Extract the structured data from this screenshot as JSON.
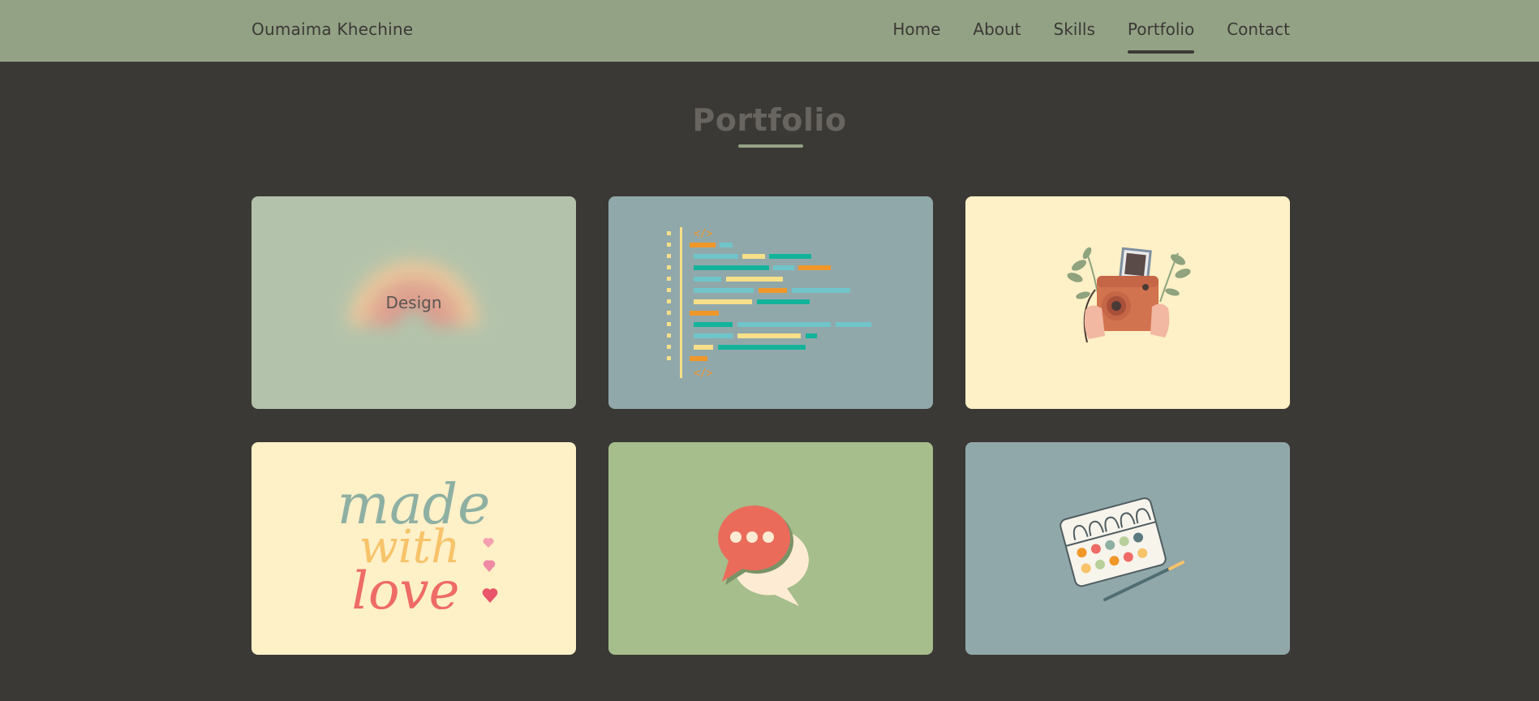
{
  "nav": {
    "brand": "Oumaima Khechine",
    "links": [
      {
        "label": "Home",
        "active": false
      },
      {
        "label": "About",
        "active": false
      },
      {
        "label": "Skills",
        "active": false
      },
      {
        "label": "Portfolio",
        "active": true
      },
      {
        "label": "Contact",
        "active": false
      }
    ]
  },
  "section": {
    "title": "Portfolio"
  },
  "portfolio": {
    "items": [
      {
        "label": "Design",
        "icon": "rainbow-icon",
        "bg": "#b3c3ab"
      },
      {
        "label": "",
        "icon": "code-icon",
        "bg": "#91a8aa"
      },
      {
        "label": "",
        "icon": "camera-icon",
        "bg": "#fef0c7"
      },
      {
        "label": "made with love",
        "icon": "lettering-icon",
        "bg": "#fef0c7"
      },
      {
        "label": "",
        "icon": "chat-bubbles-icon",
        "bg": "#a6bd8c"
      },
      {
        "label": "",
        "icon": "watercolor-palette-icon",
        "bg": "#91a8aa"
      }
    ]
  },
  "colors": {
    "page_bg": "#3b3935",
    "nav_bg": "#93a285",
    "accent": "#93a285",
    "title": "#686560"
  }
}
